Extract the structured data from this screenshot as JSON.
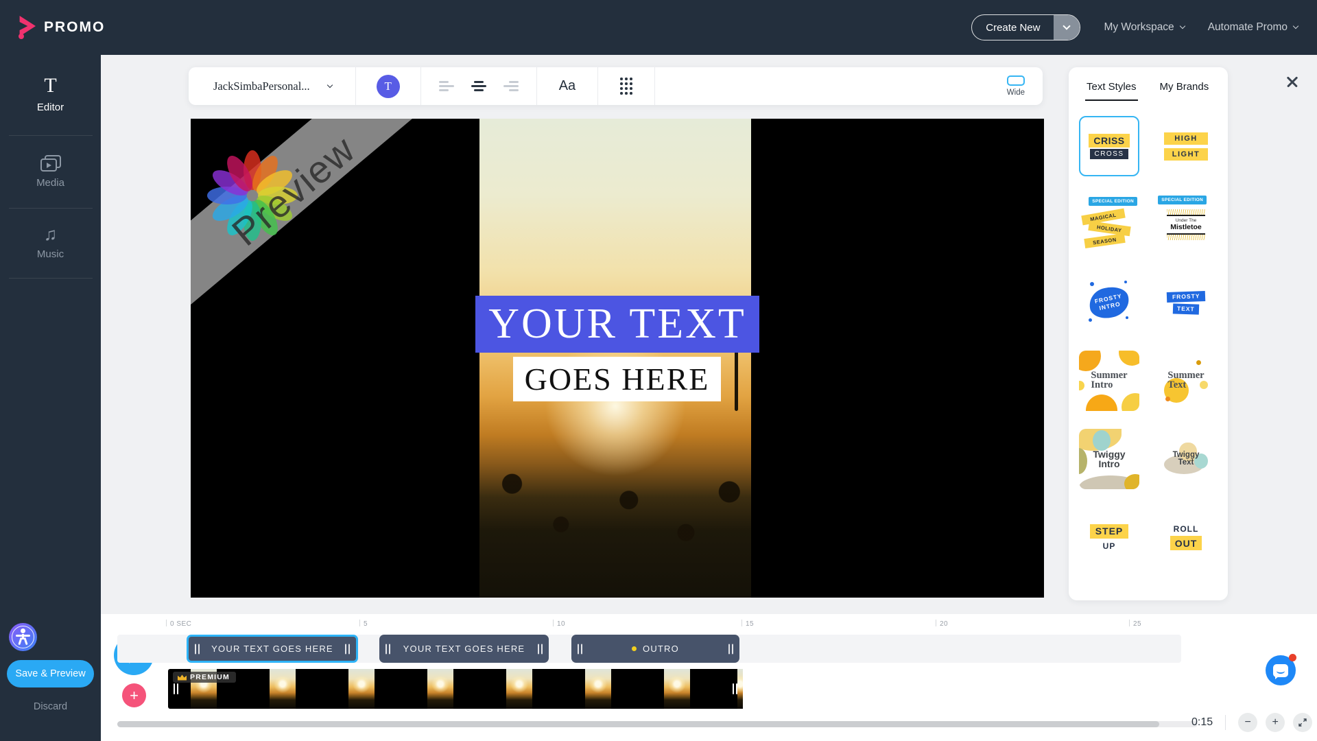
{
  "topbar": {
    "logo": "PROMO",
    "create_new": "Create New",
    "my_workspace": "My Workspace",
    "automate_promo": "Automate Promo"
  },
  "sidebar": {
    "items": [
      {
        "label": "Editor"
      },
      {
        "label": "Media"
      },
      {
        "label": "Music"
      }
    ],
    "save_preview": "Save & Preview",
    "discard": "Discard"
  },
  "toolbar": {
    "font_name": "JackSimbaPersonal...",
    "text_button": "T",
    "font_size_label": "Aa",
    "wide_label": "Wide"
  },
  "canvas": {
    "watermark": "Preview",
    "line1": "YOUR TEXT",
    "line2": "GOES HERE"
  },
  "panel": {
    "tabs": [
      {
        "label": "Text Styles",
        "active": true
      },
      {
        "label": "My Brands",
        "active": false
      }
    ],
    "styles": [
      {
        "name": "criss-cross",
        "word1": "CRISS",
        "word2": "CROSS",
        "selected": true
      },
      {
        "name": "high-light",
        "word1": "HIGH",
        "word2": "LIGHT"
      },
      {
        "name": "magical-holiday-season",
        "badge": "SPECIAL EDITION",
        "word1": "MAGICAL",
        "word2": "HOLIDAY",
        "word3": "SEASON"
      },
      {
        "name": "under-the-mistletoe",
        "badge": "SPECIAL EDITION",
        "word1": "Under The",
        "word2": "Mistletoe"
      },
      {
        "name": "frosty-intro",
        "word1": "FROSTY",
        "word2": "INTRO"
      },
      {
        "name": "frosty-text",
        "word1": "FROSTY",
        "word2": "TEXT"
      },
      {
        "name": "summer-intro",
        "word1": "Summer",
        "word2": "Intro"
      },
      {
        "name": "summer-text",
        "word1": "Summer",
        "word2": "Text"
      },
      {
        "name": "twiggy-intro",
        "word1": "Twiggy",
        "word2": "Intro"
      },
      {
        "name": "twiggy-text",
        "word1": "Twiggy",
        "word2": "Text"
      },
      {
        "name": "step-up",
        "word1": "STEP",
        "word2": "UP"
      },
      {
        "name": "roll-out",
        "word1": "ROLL",
        "word2": "OUT"
      }
    ]
  },
  "timeline": {
    "ruler": [
      "0 SEC",
      "5",
      "10",
      "15",
      "20",
      "25"
    ],
    "clips": [
      {
        "label": "YOUR TEXT GOES HERE",
        "selected": true
      },
      {
        "label": "YOUR TEXT GOES HERE",
        "selected": false
      },
      {
        "label": "OUTRO",
        "selected": false
      }
    ],
    "premium_badge": "PREMIUM",
    "duration": "0:15"
  },
  "colors": {
    "topbar_bg": "#232f3d",
    "accent_blue": "#2aa9f4",
    "selection_blue": "#2db3f7",
    "indigo_text_bar": "#4c55e2",
    "style_yellow": "#fcd34a",
    "style_blue": "#2069e0",
    "brand_pink": "#f0326e",
    "clip_slate": "#47536a"
  },
  "icons": {
    "dropdown": "chevron-down",
    "premium": "crown",
    "close": "x",
    "zoom_out": "−",
    "zoom_in": "+"
  }
}
